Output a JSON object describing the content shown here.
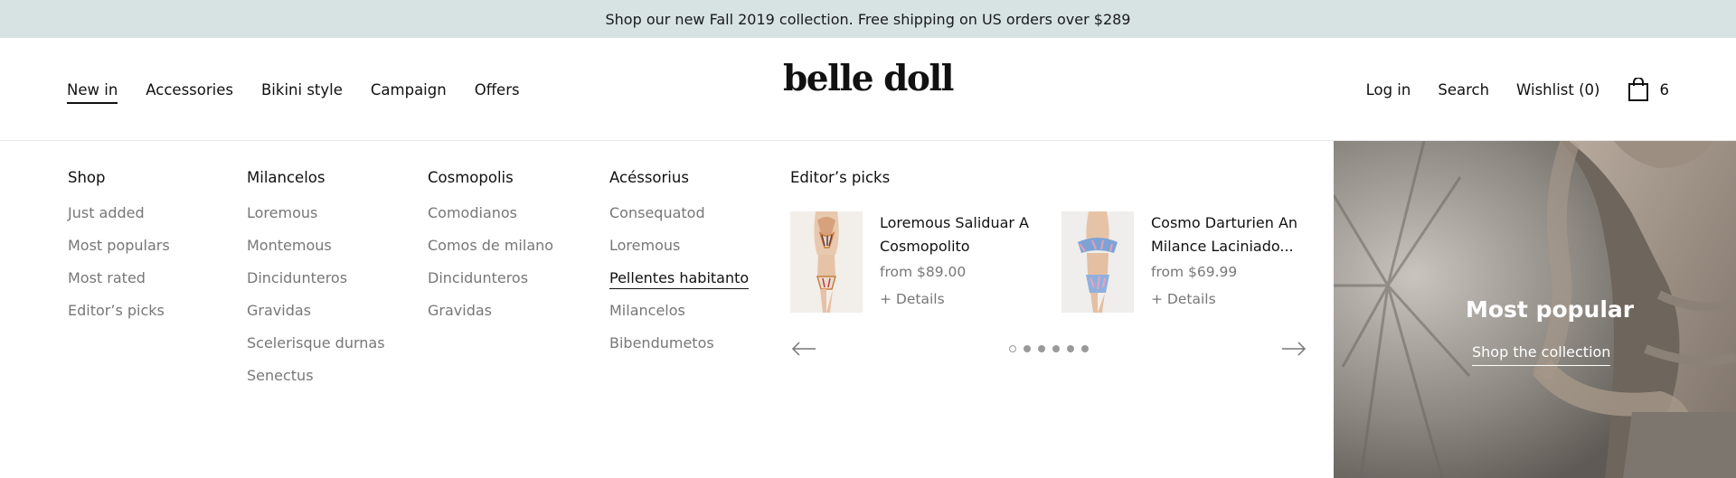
{
  "announcement": {
    "text": "Shop our new Fall 2019 collection. Free shipping on US orders over $289"
  },
  "brand": {
    "logo_text": "belle doll"
  },
  "main_nav": [
    {
      "label": "New in",
      "active": true
    },
    {
      "label": "Accessories"
    },
    {
      "label": "Bikini style"
    },
    {
      "label": "Campaign"
    },
    {
      "label": "Offers"
    }
  ],
  "utility_nav": {
    "login": "Log in",
    "search": "Search",
    "wishlist": "Wishlist (0)",
    "cart_count": "6",
    "cart_icon": "shopping-bag-icon"
  },
  "mega_menu": {
    "columns": [
      {
        "heading": "Shop",
        "items": [
          "Just added",
          "Most populars",
          "Most rated",
          "Editor’s picks"
        ]
      },
      {
        "heading": "Milancelos",
        "items": [
          "Loremous",
          "Montemous",
          "Dincidunteros",
          "Gravidas",
          "Scelerisque durnas",
          "Senectus"
        ]
      },
      {
        "heading": "Cosmopolis",
        "items": [
          "Comodianos",
          "Comos de milano",
          "Dincidunteros",
          "Gravidas"
        ]
      },
      {
        "heading": "Acéssorius",
        "items": [
          "Consequatod",
          "Loremous",
          "Pellentes habitanto",
          "Milancelos",
          "Bibendumetos"
        ],
        "underlined_index": 2
      }
    ],
    "editor_picks": {
      "heading": "Editor’s picks",
      "products": [
        {
          "title": "Loremous Saliduar A Cosmopolito",
          "price": "from $89.00",
          "details": "+ Details"
        },
        {
          "title": "Cosmo Darturien An Milance Laciniado...",
          "price": "from $69.99",
          "details": "+ Details"
        }
      ],
      "carousel": {
        "dot_count": 6,
        "active_dot": 0,
        "prev_icon": "arrow-left-icon",
        "next_icon": "arrow-right-icon"
      }
    },
    "promo": {
      "title": "Most popular",
      "link": "Shop the collection"
    }
  },
  "colors": {
    "announcement_bg": "#d6e3e2",
    "text": "#111111",
    "muted": "#777777"
  }
}
